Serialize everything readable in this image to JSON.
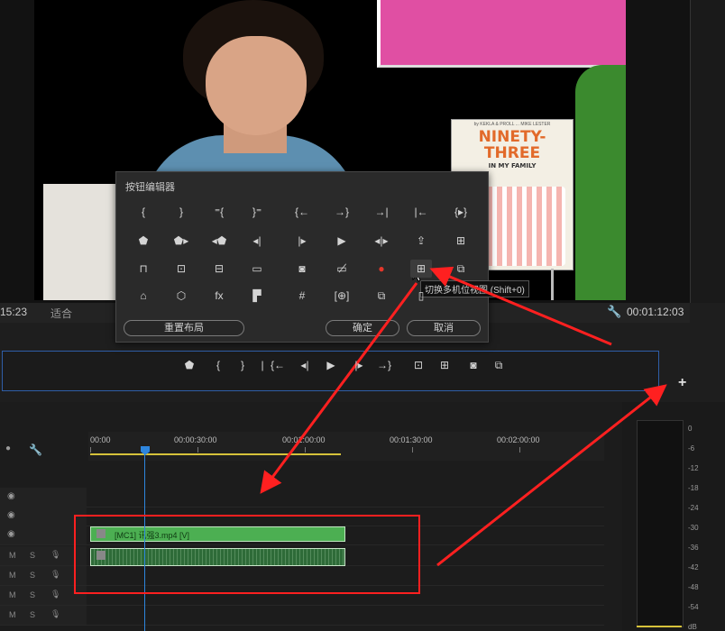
{
  "monitor": {
    "timecode_left": "15:23",
    "fit_label": "适合",
    "timecode_right": "00:01:12:03"
  },
  "book": {
    "authors": "by KEKLA & PROLL ... MIKE LESTER",
    "title_line1": "NINETY-",
    "title_line2": "THREE",
    "subtitle": "IN MY FAMILY"
  },
  "button_editor": {
    "title": "按钮编辑器",
    "tooltip": "切换多机位视图 (Shift+0)",
    "reset_label": "重置布局",
    "ok_label": "确定",
    "cancel_label": "取消",
    "buttons": [
      {
        "glyph": "{",
        "icon": "mark-in-icon"
      },
      {
        "glyph": "}",
        "icon": "mark-out-icon"
      },
      {
        "glyph": "⁼{",
        "icon": "mark-clip-icon"
      },
      {
        "glyph": "}⁼",
        "icon": "go-to-in-icon"
      },
      {
        "glyph": "{←",
        "icon": "go-to-in-point-icon"
      },
      {
        "glyph": "→}",
        "icon": "go-to-out-point-icon"
      },
      {
        "glyph": "→|",
        "icon": "go-to-next-edit-icon"
      },
      {
        "glyph": "|←",
        "icon": "go-to-prev-edit-icon"
      },
      {
        "glyph": "{▸}",
        "icon": "play-in-to-out-icon"
      },
      {
        "glyph": "⬟",
        "icon": "add-marker-icon"
      },
      {
        "glyph": "⬟▸",
        "icon": "go-to-next-marker-icon"
      },
      {
        "glyph": "◂⬟",
        "icon": "go-to-prev-marker-icon"
      },
      {
        "glyph": "◂|",
        "icon": "step-back-icon"
      },
      {
        "glyph": "|▸",
        "icon": "step-forward-icon"
      },
      {
        "glyph": "▶",
        "icon": "play-icon"
      },
      {
        "glyph": "◂|▸",
        "icon": "shuttle-icon"
      },
      {
        "glyph": "⇪",
        "icon": "export-frame-icon"
      },
      {
        "glyph": "⊞",
        "icon": "overwrite-icon"
      },
      {
        "glyph": "⊓",
        "icon": "lift-icon"
      },
      {
        "glyph": "⊡",
        "icon": "extract-icon"
      },
      {
        "glyph": "⊟",
        "icon": "insert-icon"
      },
      {
        "glyph": "▭",
        "icon": "safe-margins-icon"
      },
      {
        "glyph": "◙",
        "icon": "camera-icon"
      },
      {
        "glyph": "▭̸",
        "icon": "comment-icon"
      },
      {
        "glyph": "●",
        "icon": "record-icon"
      },
      {
        "glyph": "⊞",
        "icon": "multi-camera-view-icon"
      },
      {
        "glyph": "⧉",
        "icon": "toggle-proxies-icon"
      },
      {
        "glyph": "⌂",
        "icon": "loop-icon"
      },
      {
        "glyph": "⬡",
        "icon": "vr-video-icon"
      },
      {
        "glyph": "fx",
        "icon": "global-fx-mute-icon"
      },
      {
        "glyph": "▛",
        "icon": "compare-view-icon"
      },
      {
        "glyph": "#",
        "icon": "transmit-icon"
      },
      {
        "glyph": "[⊕]",
        "icon": "trim-icon"
      },
      {
        "glyph": "⧉",
        "icon": "stack-icon"
      },
      {
        "glyph": "▯",
        "icon": "blank-icon"
      }
    ]
  },
  "transport": {
    "buttons": [
      {
        "glyph": "⬟",
        "icon": "add-marker-icon"
      },
      {
        "glyph": "{",
        "icon": "mark-in-icon"
      },
      {
        "glyph": "}",
        "icon": "mark-out-icon"
      },
      {
        "glyph": "|",
        "icon": "separator-icon"
      },
      {
        "glyph": "{←",
        "icon": "go-to-in-icon"
      },
      {
        "glyph": "◂|",
        "icon": "step-back-icon"
      },
      {
        "glyph": "▶",
        "icon": "play-icon"
      },
      {
        "glyph": "|▸",
        "icon": "step-forward-icon"
      },
      {
        "glyph": "→}",
        "icon": "go-to-out-icon"
      },
      {
        "glyph": "⊡",
        "icon": "insert-icon"
      },
      {
        "glyph": "⊞",
        "icon": "overwrite-icon"
      },
      {
        "glyph": "◙",
        "icon": "camera-icon"
      },
      {
        "glyph": "⧉",
        "icon": "multi-camera-icon"
      }
    ],
    "add_label": "+"
  },
  "timeline": {
    "ruler": [
      "00:00",
      "00:00:30:00",
      "00:01:00:00",
      "00:01:30:00",
      "00:02:00:00"
    ],
    "video_clip_label": "[MC1] 讯强3.mp4 [V]",
    "track_m": "M",
    "track_s": "S"
  },
  "meter": {
    "db_labels": [
      "0",
      "-6",
      "-12",
      "-18",
      "-24",
      "-30",
      "-36",
      "-42",
      "-48",
      "-54",
      "dB"
    ]
  },
  "colors": {
    "accent_blue": "#2e86de",
    "clip_green": "#4caf52",
    "annotation_red": "#ff2020",
    "record_red": "#e5372b"
  }
}
